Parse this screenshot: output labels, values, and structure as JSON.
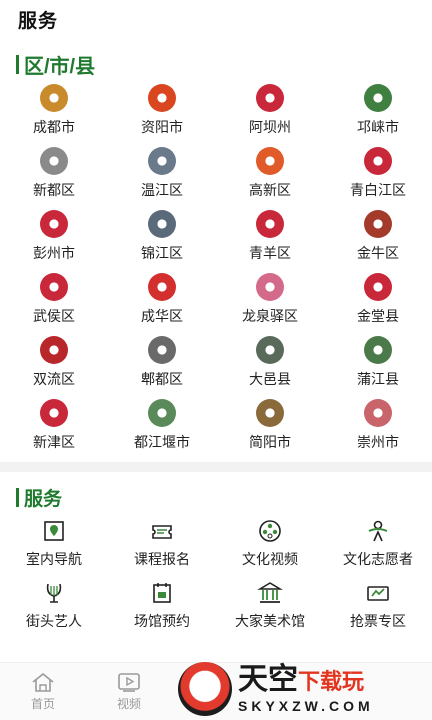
{
  "page": {
    "title": "服务"
  },
  "districts_section": {
    "title": "区/市/县"
  },
  "districts": [
    {
      "label": "成都市",
      "color": "#c98a2c"
    },
    {
      "label": "资阳市",
      "color": "#d9461f"
    },
    {
      "label": "阿坝州",
      "color": "#c8283a"
    },
    {
      "label": "邛崃市",
      "color": "#3f7f3f"
    },
    {
      "label": "新都区",
      "color": "#8a8a8a"
    },
    {
      "label": "温江区",
      "color": "#6a7a8a"
    },
    {
      "label": "高新区",
      "color": "#e05a2a"
    },
    {
      "label": "青白江区",
      "color": "#c8283a"
    },
    {
      "label": "彭州市",
      "color": "#c8283a"
    },
    {
      "label": "锦江区",
      "color": "#5a6a7a"
    },
    {
      "label": "青羊区",
      "color": "#c8283a"
    },
    {
      "label": "金牛区",
      "color": "#a33a2a"
    },
    {
      "label": "武侯区",
      "color": "#c8283a"
    },
    {
      "label": "成华区",
      "color": "#d32f2f"
    },
    {
      "label": "龙泉驿区",
      "color": "#d36a8a"
    },
    {
      "label": "金堂县",
      "color": "#c8283a"
    },
    {
      "label": "双流区",
      "color": "#b8282a"
    },
    {
      "label": "郫都区",
      "color": "#6a6a6a"
    },
    {
      "label": "大邑县",
      "color": "#5a6a5a"
    },
    {
      "label": "蒲江县",
      "color": "#4a7a4a"
    },
    {
      "label": "新津区",
      "color": "#c8283a"
    },
    {
      "label": "都江堰市",
      "color": "#5a8a5a"
    },
    {
      "label": "简阳市",
      "color": "#8a6a3a"
    },
    {
      "label": "崇州市",
      "color": "#c8646a"
    }
  ],
  "services_section": {
    "title": "服务"
  },
  "services": [
    {
      "label": "室内导航",
      "icon": "map-pin-icon"
    },
    {
      "label": "课程报名",
      "icon": "ticket-icon"
    },
    {
      "label": "文化视频",
      "icon": "film-reel-icon"
    },
    {
      "label": "文化志愿者",
      "icon": "volunteer-icon"
    },
    {
      "label": "街头艺人",
      "icon": "lyre-icon"
    },
    {
      "label": "场馆预约",
      "icon": "calendar-icon"
    },
    {
      "label": "大家美术馆",
      "icon": "museum-icon"
    },
    {
      "label": "抢票专区",
      "icon": "grab-ticket-icon"
    }
  ],
  "bottom_nav": [
    {
      "label": "首页",
      "icon": "home-icon"
    },
    {
      "label": "视频",
      "icon": "video-icon"
    }
  ],
  "watermark": {
    "main_a": "天空",
    "main_b": "下载玩",
    "sub": "SKYXZW.COM"
  },
  "theme": {
    "accent": "#1f7a2e"
  }
}
